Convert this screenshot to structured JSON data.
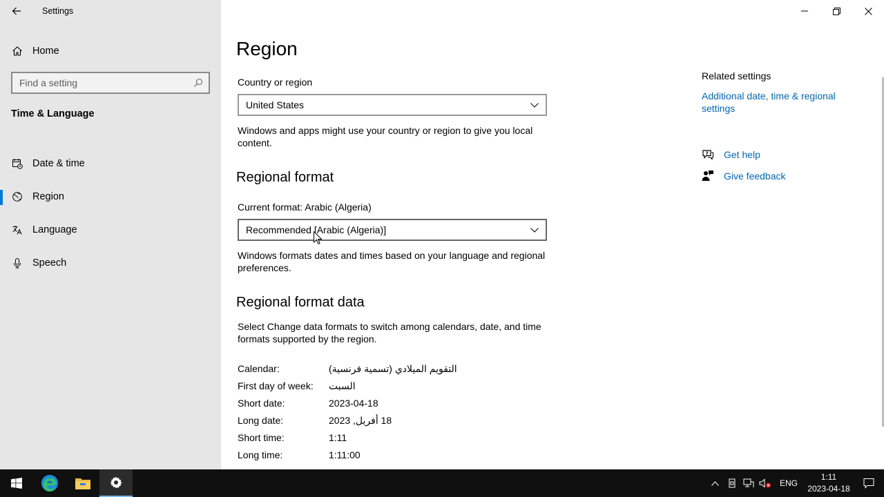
{
  "window": {
    "title": "Settings"
  },
  "sidebar": {
    "home_label": "Home",
    "search_placeholder": "Find a setting",
    "section_title": "Time & Language",
    "items": [
      {
        "label": "Date & time",
        "icon": "calendar-clock-icon"
      },
      {
        "label": "Region",
        "icon": "globe-icon",
        "active": true
      },
      {
        "label": "Language",
        "icon": "language-icon"
      },
      {
        "label": "Speech",
        "icon": "microphone-icon"
      }
    ]
  },
  "main": {
    "title": "Region",
    "country": {
      "label": "Country or region",
      "value": "United States",
      "description": "Windows and apps might use your country or region to give you local content."
    },
    "regional_format": {
      "heading": "Regional format",
      "current_label": "Current format: Arabic (Algeria)",
      "value": "Recommended [Arabic (Algeria)]",
      "description": "Windows formats dates and times based on your language and regional preferences."
    },
    "format_data": {
      "heading": "Regional format data",
      "description": "Select Change data formats to switch among calendars, date, and time formats supported by the region.",
      "rows": [
        {
          "key": "Calendar:",
          "value": "التقويم الميلادي (تسمية فرنسية)"
        },
        {
          "key": "First day of week:",
          "value": "السبت"
        },
        {
          "key": "Short date:",
          "value": "2023-04-18"
        },
        {
          "key": "Long date:",
          "value": "18 أفريل, 2023"
        },
        {
          "key": "Short time:",
          "value": "1:11"
        },
        {
          "key": "Long time:",
          "value": "1:11:00"
        }
      ]
    }
  },
  "related": {
    "title": "Related settings",
    "link": "Additional date, time & regional settings",
    "help": "Get help",
    "feedback": "Give feedback"
  },
  "taskbar": {
    "language": "ENG",
    "time": "1:11",
    "date": "2023-04-18"
  },
  "colors": {
    "accent": "#0078d7",
    "link": "#0067b8",
    "sidebar_bg": "#e6e6e6",
    "taskbar_bg": "#101010"
  }
}
